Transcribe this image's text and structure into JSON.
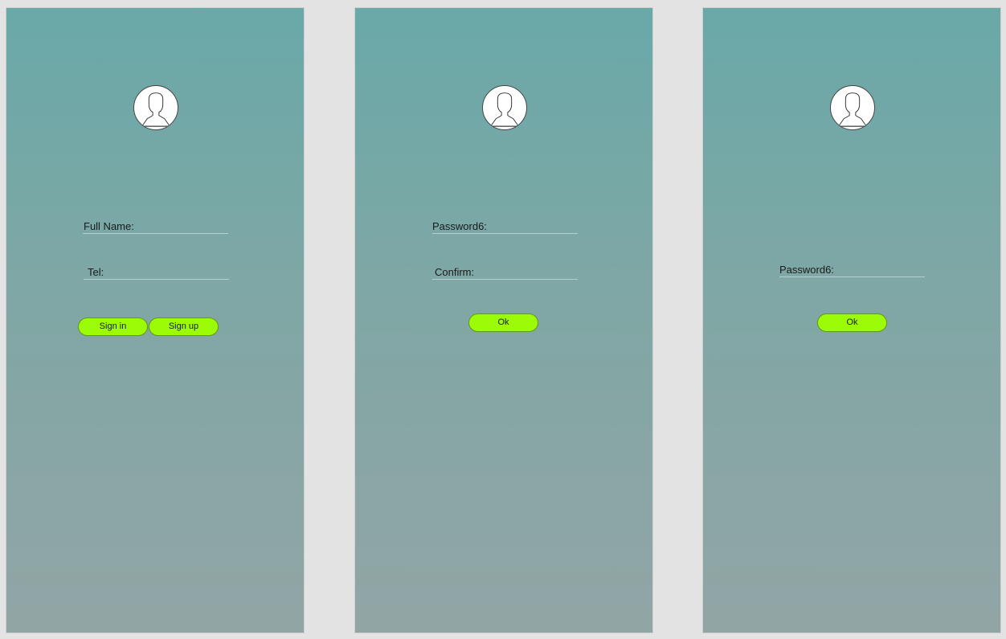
{
  "panels": [
    {
      "fields": [
        {
          "label": "Full Name:",
          "value": ""
        },
        {
          "label": "Tel:",
          "value": ""
        }
      ],
      "buttons": [
        {
          "label": "Sign in"
        },
        {
          "label": "Sign up"
        }
      ]
    },
    {
      "fields": [
        {
          "label": "Password6:",
          "value": ""
        },
        {
          "label": "Confirm:",
          "value": ""
        }
      ],
      "buttons": [
        {
          "label": "Ok"
        }
      ]
    },
    {
      "fields": [
        {
          "label": "Password6:",
          "value": ""
        }
      ],
      "buttons": [
        {
          "label": "Ok"
        }
      ]
    }
  ],
  "icons": {
    "avatar": "user-silhouette-icon"
  },
  "colors": {
    "background": "#e3e3e3",
    "panel_gradient_top": "#69a9a8",
    "panel_gradient_bottom": "#92a5a5",
    "button_fill": "#9cfb07",
    "button_border": "#5e9a1a"
  }
}
